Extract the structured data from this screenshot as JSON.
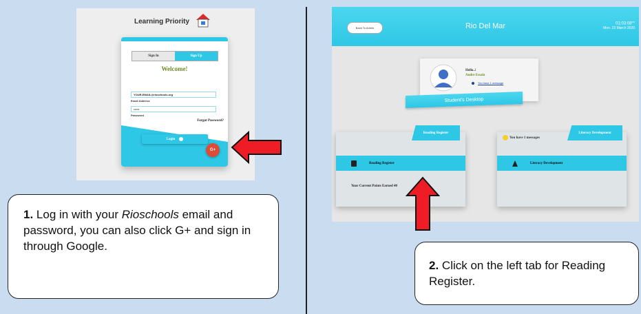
{
  "step1": {
    "login_screen": {
      "logo_text": "Learning Priority",
      "tab_sign_in": "Sign In",
      "tab_sign_up": "Sign Up",
      "welcome": "Welcome!",
      "email_value": "YOUR-EMAIL@rioschools.org",
      "email_label": "Email Address",
      "password_value": "••••••",
      "password_label": "Password",
      "forgot_password": "Forgot Password?",
      "login_button": "Login",
      "google_button": "G+"
    },
    "caption": {
      "number": "1.",
      "text_before": " Log in with your ",
      "italic": "Rioschools",
      "text_after": " email and password, you can also click G+ and sign in through Google."
    }
  },
  "step2": {
    "dashboard": {
      "back_button": "Back To Admin",
      "title": "Rio Del Mar",
      "time": "01:03:08",
      "time_suffix": "PM",
      "date": "Mon. 23 March 2020",
      "hello": "Hello..!",
      "user_name": "Andre Essala",
      "message_link": "You have 1 message",
      "desktop_label": "Student's Desktop",
      "left_panel": {
        "tab": "Reading Register",
        "row_label": "Reading Register",
        "points_text": "Your Current Points Earned 40"
      },
      "right_panel": {
        "tab": "Literacy Development",
        "messages_text": "You have 1 messages",
        "row_label": "Literacy Development"
      }
    },
    "caption": {
      "number": "2.",
      "text": " Click on the left tab for Reading Register."
    }
  },
  "colors": {
    "accent": "#2ec7e6",
    "arrow": "#ee1c24",
    "background": "#c9dcf0",
    "google": "#dd4b39"
  }
}
